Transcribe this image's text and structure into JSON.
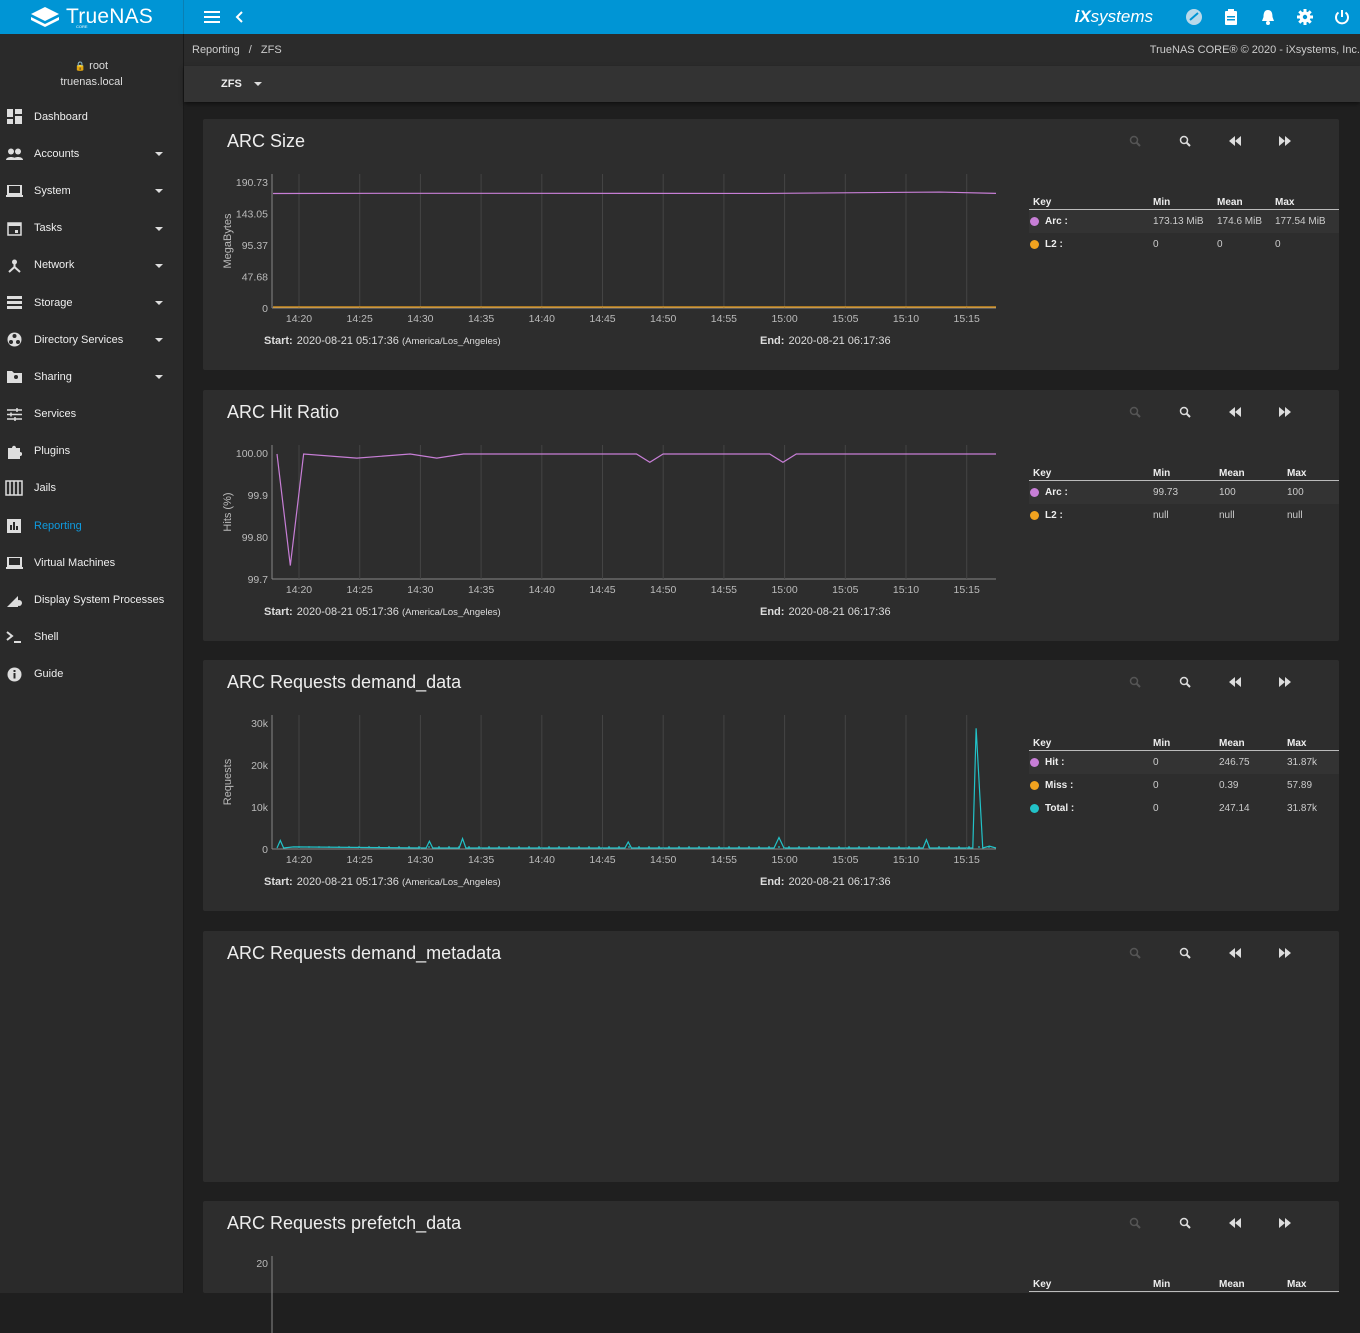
{
  "app": {
    "brand": "TrueNAS",
    "brand_sub": "CORE",
    "vendor_prefix": "iX",
    "vendor_suffix": "systems"
  },
  "user": {
    "name": "root",
    "host": "truenas.local"
  },
  "sidebar": {
    "items": [
      {
        "label": "Dashboard",
        "icon": "dashboard-icon",
        "caret": false
      },
      {
        "label": "Accounts",
        "icon": "people-icon",
        "caret": true
      },
      {
        "label": "System",
        "icon": "laptop-icon",
        "caret": true
      },
      {
        "label": "Tasks",
        "icon": "calendar-icon",
        "caret": true
      },
      {
        "label": "Network",
        "icon": "network-icon",
        "caret": true
      },
      {
        "label": "Storage",
        "icon": "storage-icon",
        "caret": true
      },
      {
        "label": "Directory Services",
        "icon": "directory-icon",
        "caret": true
      },
      {
        "label": "Sharing",
        "icon": "folder-share-icon",
        "caret": true
      },
      {
        "label": "Services",
        "icon": "tune-icon",
        "caret": false
      },
      {
        "label": "Plugins",
        "icon": "puzzle-icon",
        "caret": false
      },
      {
        "label": "Jails",
        "icon": "jail-icon",
        "caret": false
      },
      {
        "label": "Reporting",
        "icon": "chart-icon",
        "caret": false,
        "active": true
      },
      {
        "label": "Virtual Machines",
        "icon": "monitor-icon",
        "caret": false
      },
      {
        "label": "Display System Processes",
        "icon": "processes-icon",
        "caret": false
      },
      {
        "label": "Shell",
        "icon": "terminal-icon",
        "caret": false
      },
      {
        "label": "Guide",
        "icon": "info-icon",
        "caret": false
      }
    ]
  },
  "breadcrumb": {
    "parent": "Reporting",
    "sep": "/",
    "current": "ZFS"
  },
  "copyright": "TrueNAS CORE® © 2020 - iXsystems, Inc.",
  "filter": {
    "selected": "ZFS"
  },
  "colors": {
    "accent": "#0095d5",
    "arc": "#c77ed6",
    "l2": "#f0a21f",
    "total": "#22c2c8"
  },
  "chart_data": [
    {
      "type": "line",
      "title": "ARC Size",
      "ylabel": "MegaBytes",
      "yticks": [
        "190.73",
        "143.05",
        "95.37",
        "47.68",
        "0"
      ],
      "ylim": [
        0,
        190.73
      ],
      "x_ticks": [
        "14:20",
        "14:25",
        "14:30",
        "14:35",
        "14:40",
        "14:45",
        "14:50",
        "14:55",
        "15:00",
        "15:05",
        "15:10",
        "15:15"
      ],
      "series": [
        {
          "name": "Arc",
          "color": "#c77ed6",
          "points": [
            [
              14.3,
              174.6
            ],
            [
              14.5,
              174.9
            ],
            [
              15.0,
              174.7
            ],
            [
              15.25,
              176.8
            ],
            [
              15.33,
              174.8
            ]
          ]
        },
        {
          "name": "L2",
          "color": "#f0a21f",
          "points": [
            [
              14.3,
              0
            ],
            [
              15.33,
              0
            ]
          ]
        }
      ],
      "legend": {
        "headers": [
          "Key",
          "Min",
          "Mean",
          "Max"
        ],
        "rows": [
          {
            "key": "Arc :",
            "min": "173.13 MiB",
            "mean": "174.6 MiB",
            "max": "177.54 MiB",
            "color": "#c77ed6"
          },
          {
            "key": "L2 :",
            "min": "0",
            "mean": "0",
            "max": "0",
            "color": "#f0a21f"
          }
        ]
      },
      "start_label": "Start:",
      "start": "2020-08-21 05:17:36",
      "start_tz": "(America/Los_Angeles)",
      "end_label": "End:",
      "end": "2020-08-21 06:17:36"
    },
    {
      "type": "line",
      "title": "ARC Hit Ratio",
      "ylabel": "Hits (%)",
      "yticks": [
        "100.00",
        "99.9",
        "99.80",
        "99.7"
      ],
      "ylim": [
        99.7,
        100
      ],
      "x_ticks": [
        "14:20",
        "14:25",
        "14:30",
        "14:35",
        "14:40",
        "14:45",
        "14:50",
        "14:55",
        "15:00",
        "15:05",
        "15:10",
        "15:15"
      ],
      "series": [
        {
          "name": "Arc",
          "color": "#c77ed6",
          "points": [
            [
              14.3,
              100
            ],
            [
              14.35,
              99.73
            ],
            [
              14.4,
              100
            ],
            [
              14.6,
              99.99
            ],
            [
              14.8,
              100
            ],
            [
              14.9,
              99.99
            ],
            [
              15.0,
              100
            ],
            [
              15.65,
              100
            ],
            [
              15.7,
              99.98
            ],
            [
              15.75,
              100
            ],
            [
              16.15,
              100
            ],
            [
              16.2,
              99.98
            ],
            [
              16.25,
              100
            ],
            [
              16.3,
              100
            ],
            [
              17.0,
              100
            ]
          ]
        }
      ],
      "legend": {
        "headers": [
          "Key",
          "Min",
          "Mean",
          "Max"
        ],
        "rows": [
          {
            "key": "Arc :",
            "min": "99.73",
            "mean": "100",
            "max": "100",
            "color": "#c77ed6"
          },
          {
            "key": "L2 :",
            "min": "null",
            "mean": "null",
            "max": "null",
            "color": "#f0a21f"
          }
        ]
      },
      "start_label": "Start:",
      "start": "2020-08-21 05:17:36",
      "start_tz": "(America/Los_Angeles)",
      "end_label": "End:",
      "end": "2020-08-21 06:17:36"
    },
    {
      "type": "line",
      "title": "ARC Requests demand_data",
      "ylabel": "Requests",
      "yticks": [
        "30k",
        "20k",
        "10k",
        "0"
      ],
      "ylim": [
        0,
        33000
      ],
      "x_ticks": [
        "14:20",
        "14:25",
        "14:30",
        "14:35",
        "14:40",
        "14:45",
        "14:50",
        "14:55",
        "15:00",
        "15:05",
        "15:10",
        "15:15"
      ],
      "series": [
        {
          "name": "Total",
          "color": "#22c2c8",
          "points": [
            [
              14.3,
              0
            ],
            [
              14.32,
              2000
            ],
            [
              14.34,
              0
            ],
            [
              14.4,
              300
            ],
            [
              15.2,
              0
            ],
            [
              15.22,
              1800
            ],
            [
              15.24,
              0
            ],
            [
              15.4,
              0
            ],
            [
              15.42,
              2500
            ],
            [
              15.44,
              0
            ],
            [
              16.4,
              0
            ],
            [
              16.42,
              1600
            ],
            [
              16.44,
              0
            ],
            [
              17.3,
              0
            ],
            [
              17.33,
              2800
            ],
            [
              17.36,
              0
            ],
            [
              17.5,
              0
            ],
            [
              18.2,
              0
            ],
            [
              18.22,
              2200
            ],
            [
              18.24,
              0
            ],
            [
              18.5,
              0
            ],
            [
              18.52,
              31870
            ],
            [
              18.56,
              0
            ],
            [
              18.6,
              500
            ],
            [
              18.64,
              0
            ]
          ]
        }
      ],
      "legend": {
        "headers": [
          "Key",
          "Min",
          "Mean",
          "Max"
        ],
        "rows": [
          {
            "key": "Hit :",
            "min": "0",
            "mean": "246.75",
            "max": "31.87k",
            "color": "#c77ed6"
          },
          {
            "key": "Miss :",
            "min": "0",
            "mean": "0.39",
            "max": "57.89",
            "color": "#f0a21f"
          },
          {
            "key": "Total :",
            "min": "0",
            "mean": "247.14",
            "max": "31.87k",
            "color": "#22c2c8"
          }
        ]
      },
      "start_label": "Start:",
      "start": "2020-08-21 05:17:36",
      "start_tz": "(America/Los_Angeles)",
      "end_label": "End:",
      "end": "2020-08-21 06:17:36"
    },
    {
      "type": "line",
      "title": "ARC Requests demand_metadata"
    },
    {
      "type": "line",
      "title": "ARC Requests prefetch_data",
      "yticks": [
        "20"
      ],
      "legend": {
        "headers": [
          "Key",
          "Min",
          "Mean",
          "Max"
        ]
      }
    }
  ]
}
